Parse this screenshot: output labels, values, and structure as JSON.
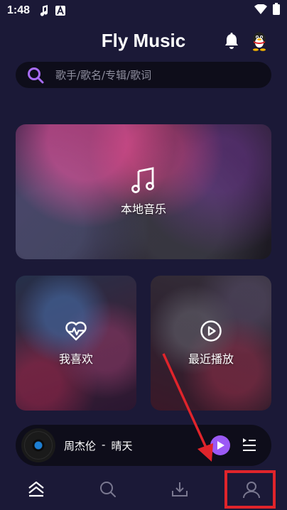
{
  "status_bar": {
    "time": "1:48"
  },
  "header": {
    "title": "Fly Music"
  },
  "search": {
    "placeholder": "歌手/歌名/专辑/歌词"
  },
  "cards": {
    "local": {
      "label": "本地音乐"
    },
    "favorites": {
      "label": "我喜欢"
    },
    "recent": {
      "label": "最近播放"
    }
  },
  "player": {
    "artist": "周杰伦",
    "separator": "-",
    "song": "晴天"
  },
  "colors": {
    "background": "#1b1937",
    "accent": "#9b59f5",
    "annotation": "#e0242b"
  },
  "icons": {
    "status": [
      "music-note-icon",
      "text-a-icon",
      "wifi-icon",
      "battery-icon"
    ],
    "header": [
      "bell-icon",
      "qq-penguin-icon"
    ],
    "nav": [
      "home-icon",
      "search-icon",
      "download-icon",
      "profile-icon"
    ]
  }
}
